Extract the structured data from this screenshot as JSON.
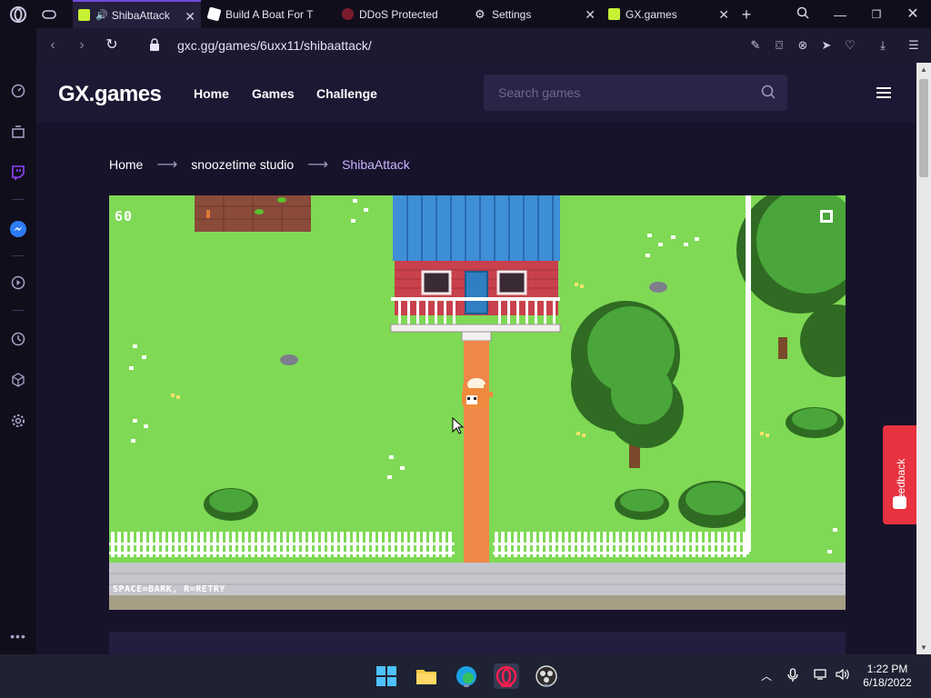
{
  "browser": {
    "tabs": [
      {
        "label": "ShibaAttack",
        "active": true,
        "icon": "gx-games-favicon"
      },
      {
        "label": "Build A Boat For T",
        "active": false,
        "icon": "roblox-favicon"
      },
      {
        "label": "DDoS Protected",
        "active": false,
        "icon": "ddos-favicon"
      },
      {
        "label": "Settings",
        "active": false,
        "icon": "gear-icon"
      },
      {
        "label": "GX.games",
        "active": false,
        "icon": "gx-games-favicon"
      }
    ],
    "url": "gxc.gg/games/6uxx11/shibaattack/"
  },
  "site": {
    "logo": "GX.games",
    "nav": [
      "Home",
      "Games",
      "Challenge"
    ],
    "search_placeholder": "Search games"
  },
  "breadcrumb": {
    "home": "Home",
    "studio": "snoozetime studio",
    "game": "ShibaAttack"
  },
  "game": {
    "hud_score": "60",
    "controls_hint": "SPACE=BARK, R=RETRY"
  },
  "feedback_label": "Feedback",
  "taskbar": {
    "time": "1:22 PM",
    "date": "6/18/2022"
  },
  "colors": {
    "accent": "#6f4bd8",
    "grass": "#7fd955",
    "path": "#f0874a",
    "roof": "#3f8fd6",
    "house": "#c8414d",
    "feedback": "#e8323f"
  }
}
